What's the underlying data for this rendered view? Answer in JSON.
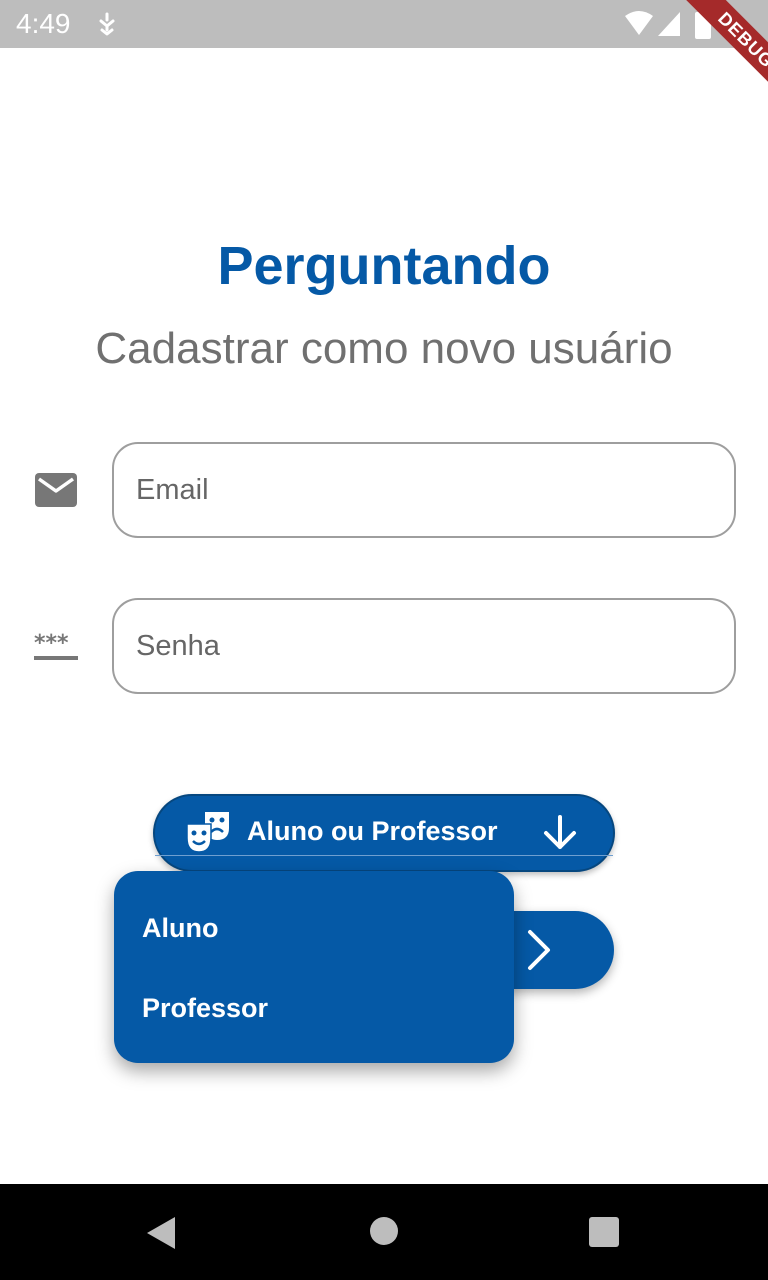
{
  "status_bar": {
    "time": "4:49",
    "icons": [
      "notification-icon",
      "wifi-icon",
      "signal-icon",
      "battery-icon"
    ]
  },
  "debug_banner": {
    "label": "DEBUG"
  },
  "header": {
    "title": "Perguntando",
    "subtitle": "Cadastrar como novo usuário"
  },
  "form": {
    "email": {
      "placeholder": "Email",
      "value": "",
      "icon": "email-icon"
    },
    "password": {
      "placeholder": "Senha",
      "value": "",
      "icon": "password-icon"
    },
    "role_dropdown": {
      "label": "Aluno ou Professor",
      "icon": "theater-masks-icon",
      "trailing_icon": "arrow-down-icon",
      "options": [
        "Aluno",
        "Professor"
      ]
    },
    "next_button": {
      "icon": "chevron-right-icon"
    }
  },
  "nav_bar": {
    "icons": [
      "back-icon",
      "home-icon",
      "recents-icon"
    ]
  },
  "colors": {
    "primary": "#0559a6",
    "subtitle_gray": "#707070",
    "status_bar": "#bdbdbd",
    "debug_ribbon": "#a52a2a"
  }
}
